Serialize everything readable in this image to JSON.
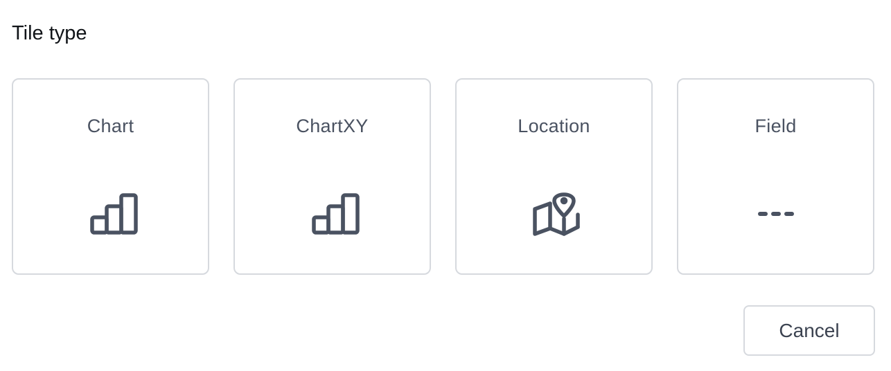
{
  "dialog": {
    "title": "Tile type"
  },
  "tiles": [
    {
      "label": "Chart",
      "icon": "bar-chart-icon"
    },
    {
      "label": "ChartXY",
      "icon": "bar-chart-icon"
    },
    {
      "label": "Location",
      "icon": "map-pin-icon"
    },
    {
      "label": "Field",
      "icon": "dashes-icon"
    }
  ],
  "actions": {
    "cancel_label": "Cancel"
  },
  "colors": {
    "icon": "#4a5261",
    "border": "#d6d9de",
    "text": "#111418"
  }
}
